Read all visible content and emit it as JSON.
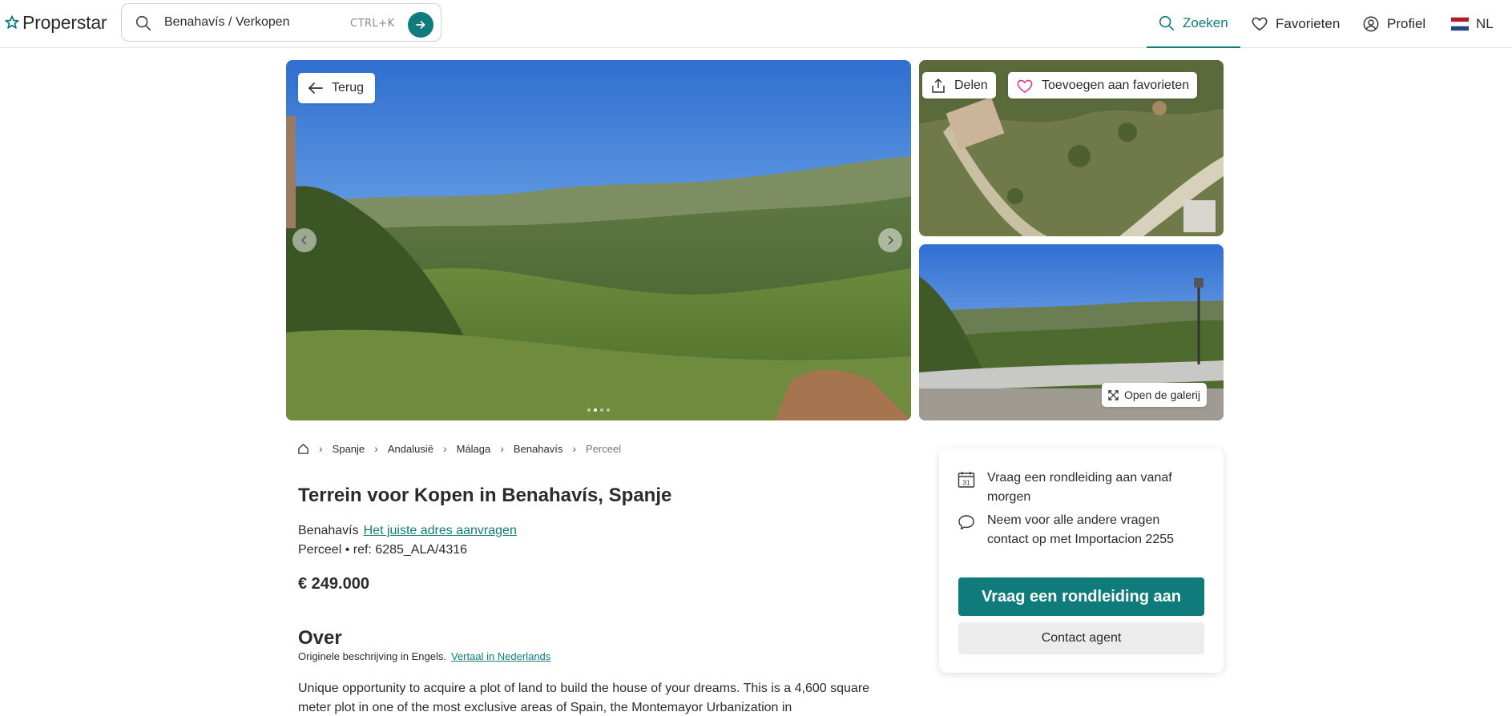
{
  "header": {
    "brand": "Properstar",
    "search_text": "Benahavís / Verkopen",
    "shortcut": "CTRL+K",
    "nav": {
      "search": "Zoeken",
      "favorites": "Favorieten",
      "profile": "Profiel",
      "language": "NL"
    }
  },
  "gallery": {
    "back_label": "Terug",
    "share_label": "Delen",
    "favorite_label": "Toevoegen aan favorieten",
    "open_gallery_label": "Open de galerij",
    "dots_count": 4,
    "active_dot": 2
  },
  "breadcrumb": [
    "Spanje",
    "Andalusië",
    "Málaga",
    "Benahavís",
    "Perceel"
  ],
  "listing": {
    "title": "Terrein voor Kopen in Benahavís, Spanje",
    "location": "Benahavís",
    "address_link": "Het juiste adres aanvragen",
    "ref_line": "Perceel • ref: 6285_ALA/4316",
    "price": "€ 249.000"
  },
  "about": {
    "heading": "Over",
    "original_note": "Originele beschrijving in Engels.",
    "translate_link": "Vertaal in Nederlands",
    "description": "Unique opportunity to acquire a plot of land to build the house of your dreams. This is a 4,600 square meter plot in one of the most exclusive areas of Spain, the Montemayor Urbanization in"
  },
  "contact_card": {
    "calendar_day": "31",
    "tour_text": "Vraag een rondleiding aan vanaf morgen",
    "questions_text": "Neem voor alle andere vragen contact op met Importacion 2255",
    "primary_button": "Vraag een rondleiding aan",
    "secondary_button": "Contact agent"
  },
  "colors": {
    "accent": "#0f7c7b",
    "favorite_heart": "#e0338a"
  }
}
